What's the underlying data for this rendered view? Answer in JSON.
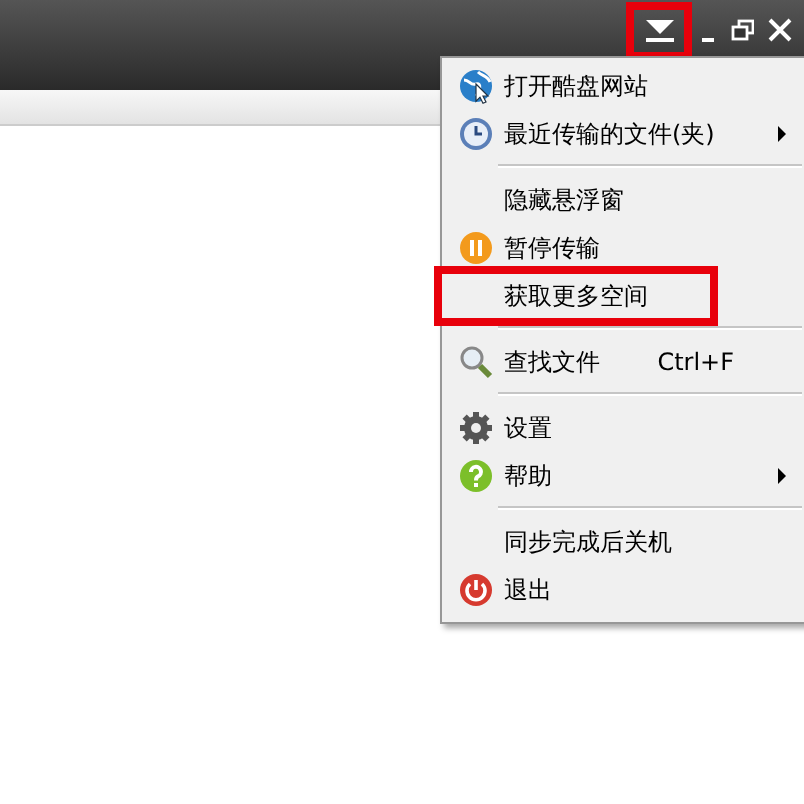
{
  "title_bar": {
    "menu_button": {
      "annotated": true
    },
    "controls": [
      {
        "kind": "minimize"
      },
      {
        "kind": "restore"
      },
      {
        "kind": "close"
      }
    ]
  },
  "menu": {
    "items": [
      {
        "kind": "item",
        "label": "打开酷盘网站",
        "submenu": false,
        "annotated": false
      },
      {
        "kind": "item",
        "label": "最近传输的文件(夹)",
        "submenu": true,
        "annotated": false
      },
      {
        "kind": "separator"
      },
      {
        "kind": "item",
        "label": "隐藏悬浮窗",
        "submenu": false,
        "annotated": false
      },
      {
        "kind": "item",
        "label": "暂停传输",
        "submenu": false,
        "annotated": false
      },
      {
        "kind": "item",
        "label": "获取更多空间",
        "submenu": false,
        "annotated": true
      },
      {
        "kind": "separator"
      },
      {
        "kind": "item",
        "label": "查找文件",
        "shortcut": "Ctrl+F",
        "submenu": false,
        "annotated": false
      },
      {
        "kind": "separator"
      },
      {
        "kind": "item",
        "label": "设置",
        "submenu": false,
        "annotated": false
      },
      {
        "kind": "item",
        "label": "帮助",
        "submenu": true,
        "annotated": false
      },
      {
        "kind": "separator"
      },
      {
        "kind": "item",
        "label": "同步完成后关机",
        "submenu": false,
        "annotated": false
      },
      {
        "kind": "item",
        "label": "退出",
        "submenu": false,
        "annotated": false
      }
    ]
  }
}
